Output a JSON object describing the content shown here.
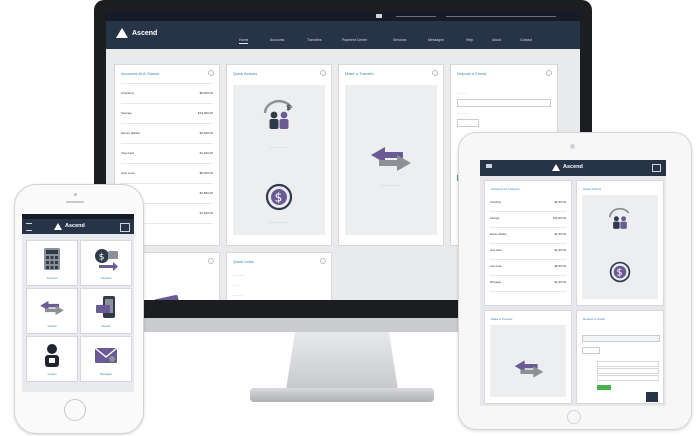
{
  "colors": {
    "navbar": "#273447",
    "topbar": "#151c28",
    "accent": "#3a82b8",
    "icon_purple": "#6b5b95",
    "icon_gray": "#8d9097",
    "success_green": "#4caf50"
  },
  "brand": {
    "name": "Ascend"
  },
  "desktop": {
    "nav_items": [
      "Home",
      "Accounts",
      "Transfers",
      "Payment Center",
      "Services",
      "Messages",
      "Help",
      "About",
      "Contact"
    ],
    "widgets": {
      "accounts": {
        "title": "Accounts At A Glance",
        "rows": [
          {
            "name": "Checking",
            "sub": "",
            "value": "$5,000.00"
          },
          {
            "name": "Savings",
            "sub": "",
            "value": "$19,000.00"
          },
          {
            "name": "Money Market",
            "sub": "",
            "value": "$4,000.00"
          },
          {
            "name": "Visa Card",
            "sub": "",
            "value": "$1,200.00"
          },
          {
            "name": "Auto Loan",
            "sub": "",
            "value": "$8,000.00"
          },
          {
            "name": "Home Equity",
            "sub": "",
            "value": "$2,800.00"
          },
          {
            "name": "Mortgage",
            "sub": "",
            "value": "$1,200.00"
          }
        ]
      },
      "quick": {
        "title": "Quick Actions"
      },
      "transfer": {
        "title": "Make a Transfer"
      },
      "deposit": {
        "title": "Deposit a Check"
      },
      "bill": {
        "title": "Bill Payment"
      },
      "help": {
        "title": "Quick Links"
      }
    }
  },
  "tablet": {
    "accounts_title": "Accounts At A Glance",
    "quick_title": "Quick Actions",
    "transfer_title": "Make a Transfer",
    "deposit_title": "Deposit a Check",
    "rows": [
      {
        "name": "Checking",
        "value": "$5,000.00"
      },
      {
        "name": "Savings",
        "value": "$19,000.00"
      },
      {
        "name": "Money Market",
        "value": "$4,000.00"
      },
      {
        "name": "Visa Card",
        "value": "$1,200.00"
      },
      {
        "name": "Auto Loan",
        "value": "$8,000.00"
      },
      {
        "name": "Mortgage",
        "value": "$1,200.00"
      }
    ]
  },
  "phone": {
    "tiles": [
      {
        "label": "Accounts",
        "icon": "calculator-icon"
      },
      {
        "label": "Transfers",
        "icon": "transfer-money-icon"
      },
      {
        "label": "Transfer",
        "icon": "transfer-arrows-icon"
      },
      {
        "label": "Deposit",
        "icon": "mobile-deposit-icon"
      },
      {
        "label": "Contact",
        "icon": "person-icon"
      },
      {
        "label": "Messages",
        "icon": "envelope-icon"
      }
    ]
  }
}
